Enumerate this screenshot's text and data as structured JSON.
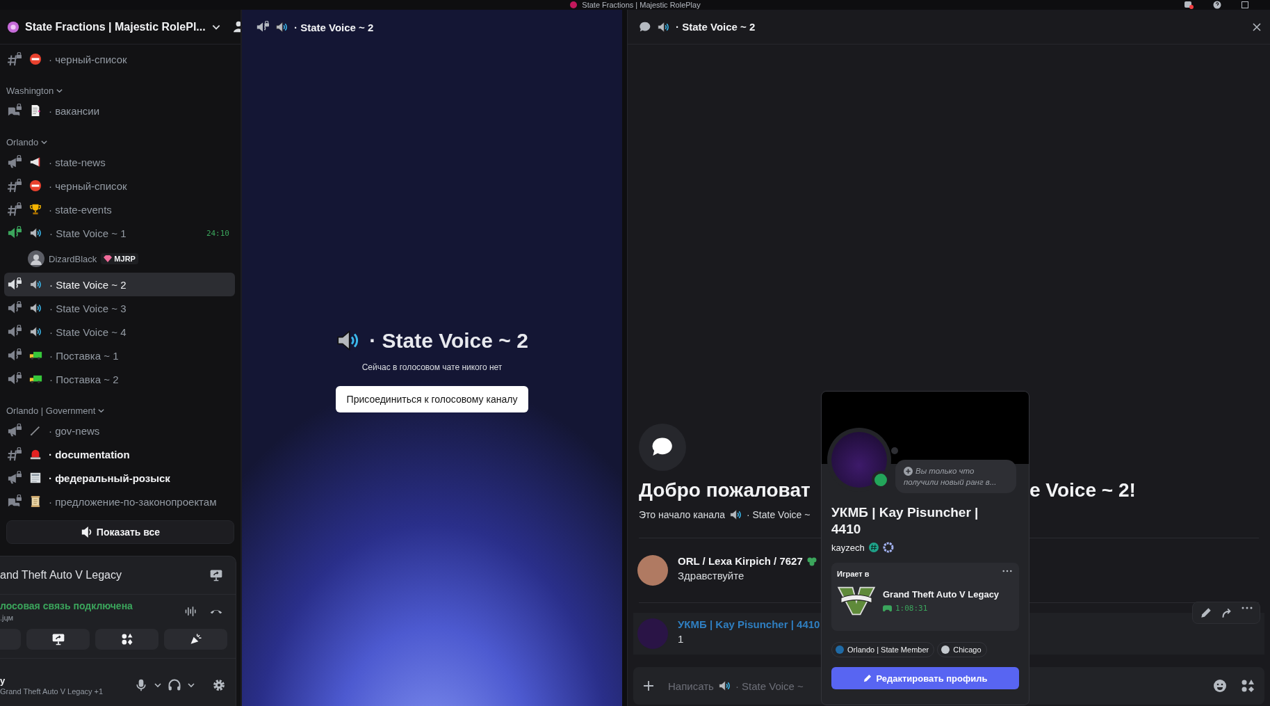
{
  "window": {
    "title": "State Fractions | Majestic RolePlay"
  },
  "server": {
    "name": "State Fractions | Majestic RolePl..."
  },
  "sections": [
    {
      "channels": [
        {
          "kind": "text",
          "emoji": {
            "kind": "no-entry"
          },
          "name": "· черный-список",
          "unread": false,
          "selected": false,
          "active": false
        }
      ]
    },
    {
      "name": "Washington",
      "expanded": true,
      "channels": [
        {
          "kind": "forum",
          "emoji": {
            "kind": "memo"
          },
          "name": "· вакансии",
          "unread": false,
          "selected": false,
          "active": false
        }
      ]
    },
    {
      "name": "Orlando",
      "expanded": true,
      "channels": [
        {
          "kind": "announcement",
          "emoji": {
            "kind": "megaphone"
          },
          "name": "· state-news",
          "unread": false,
          "selected": false,
          "active": false
        },
        {
          "kind": "text",
          "emoji": {
            "kind": "no-entry"
          },
          "name": "· черный-список",
          "unread": false,
          "selected": false,
          "active": false
        },
        {
          "kind": "text",
          "emoji": {
            "kind": "trophy"
          },
          "name": "· state-events",
          "unread": false,
          "selected": false,
          "active": false
        },
        {
          "kind": "voice",
          "emoji": {
            "kind": "speaker"
          },
          "name": "· State Voice ~ 1",
          "unread": false,
          "selected": false,
          "active": true,
          "timer": "24:10",
          "members": [
            {
              "name": "DizardBlack",
              "tag": "MJRP"
            }
          ]
        },
        {
          "kind": "voice",
          "emoji": {
            "kind": "speaker"
          },
          "name": "· State Voice ~ 2",
          "unread": false,
          "selected": true,
          "active": false
        },
        {
          "kind": "voice",
          "emoji": {
            "kind": "speaker"
          },
          "name": "· State Voice ~ 3",
          "unread": false,
          "selected": false,
          "active": false
        },
        {
          "kind": "voice",
          "emoji": {
            "kind": "speaker"
          },
          "name": "· State Voice ~ 4",
          "unread": false,
          "selected": false,
          "active": false
        },
        {
          "kind": "voice",
          "emoji": {
            "kind": "truck"
          },
          "name": "· Поставка ~ 1",
          "unread": false,
          "selected": false,
          "active": false
        },
        {
          "kind": "voice",
          "emoji": {
            "kind": "truck"
          },
          "name": "· Поставка ~ 2",
          "unread": false,
          "selected": false,
          "active": false
        }
      ]
    },
    {
      "name": "Orlando | Government",
      "expanded": true,
      "channels": [
        {
          "kind": "announcement",
          "emoji": {
            "kind": "pencil"
          },
          "name": "· gov-news",
          "unread": false,
          "selected": false,
          "active": false
        },
        {
          "kind": "text",
          "emoji": {
            "kind": "siren"
          },
          "name": "· documentation",
          "unread": true,
          "selected": false,
          "active": false
        },
        {
          "kind": "announcement",
          "emoji": {
            "kind": "newspaper"
          },
          "name": "· федеральный-розыск",
          "unread": true,
          "selected": false,
          "active": false
        },
        {
          "kind": "forum",
          "emoji": {
            "kind": "scroll"
          },
          "name": "· предложение-по-законопроектам",
          "unread": false,
          "selected": false,
          "active": false
        }
      ]
    }
  ],
  "show_all_button": "Показать все",
  "activity_panel": {
    "game": "and Theft Auto V Legacy",
    "status": "лосовая связь подключена",
    "detail": ".jɥм"
  },
  "user_panel": {
    "name": "y",
    "status": "Grand Theft Auto V Legacy +1"
  },
  "voice_stage": {
    "header": "· State Voice ~ 2",
    "title": "· State Voice ~ 2",
    "subtitle": "Сейчас в голосовом чате никого нет",
    "join_button": "Присоединиться к голосовому каналу"
  },
  "chat": {
    "header": "· State Voice ~ 2",
    "welcome_start": "Добро пожаловат",
    "welcome_end": "e Voice ~ 2!",
    "intro_text": "Это начало канала",
    "intro_channel": "· State Voice ~",
    "messages": [
      {
        "author": "ORL / Lexa Kirpich / 7627",
        "text": "Здравствуйте",
        "color": "#f2f3f5",
        "highlighted": false
      },
      {
        "author": "УКМБ | Kay Pisuncher | 4410",
        "text": "1",
        "color": "#2f7fc1",
        "highlighted": true
      }
    ],
    "composer": {
      "placeholder_start": "Написать",
      "placeholder_channel": "· State Voice ~"
    }
  },
  "profile": {
    "display_name": "УКМБ | Kay Pisuncher | 4410",
    "username": "kayzech",
    "status_note": "Вы только что получили новый ранг в...",
    "online": true,
    "activity": {
      "label": "Играет в",
      "game": "Grand Theft Auto V Legacy",
      "elapsed": "1:08:31"
    },
    "roles": [
      {
        "name": "Orlando | State Member",
        "color": "#1f6aa5"
      },
      {
        "name": "Chicago",
        "color": "#c4c9ce"
      }
    ],
    "edit_button": "Редактировать профиль"
  }
}
